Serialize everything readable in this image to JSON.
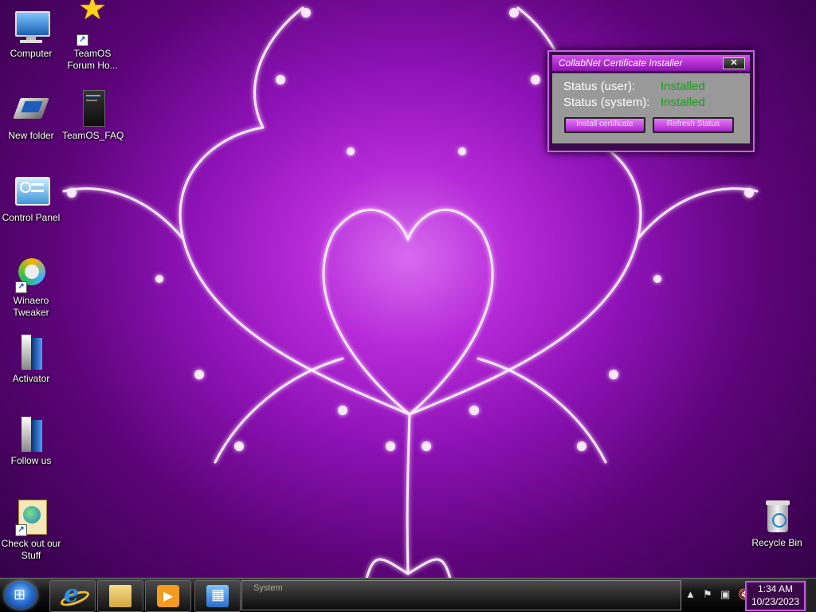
{
  "desktop": {
    "icons_left": [
      {
        "label": "Computer",
        "icon": "computer-icon"
      },
      {
        "label": "New folder",
        "icon": "folder-icon"
      },
      {
        "label": "Control Panel",
        "icon": "control-panel-icon"
      },
      {
        "label": "Winaero Tweaker",
        "icon": "winaero-tweaker-icon"
      },
      {
        "label": "Activator",
        "icon": "activator-icon"
      },
      {
        "label": "Follow us",
        "icon": "follow-us-icon"
      },
      {
        "label": "Check out our Stuff",
        "icon": "check-out-icon"
      }
    ],
    "icons_second": [
      {
        "label": "TeamOS Forum Ho...",
        "icon": "star-shortcut-icon"
      },
      {
        "label": "TeamOS_FAQ",
        "icon": "document-icon"
      }
    ],
    "recycle_bin": {
      "label": "Recycle Bin",
      "icon": "recycle-bin-icon"
    }
  },
  "installer": {
    "title": "CollabNet Certificate Installer",
    "close_label": "✕",
    "status_user_label": "Status (user):",
    "status_user_value": "Installed",
    "status_system_label": "Status (system):",
    "status_system_value": "Installed",
    "install_button": "Install certificate",
    "refresh_button": "Refresh Status",
    "status_color": "#1aa01a"
  },
  "taskbar": {
    "active_window_label": "System",
    "buttons": [
      "internet-explorer-icon",
      "file-explorer-icon",
      "media-player-icon",
      "system-icon"
    ],
    "clock": {
      "time": "1:34 AM",
      "date": "10/23/2023"
    },
    "accent": "#d14cf0"
  }
}
